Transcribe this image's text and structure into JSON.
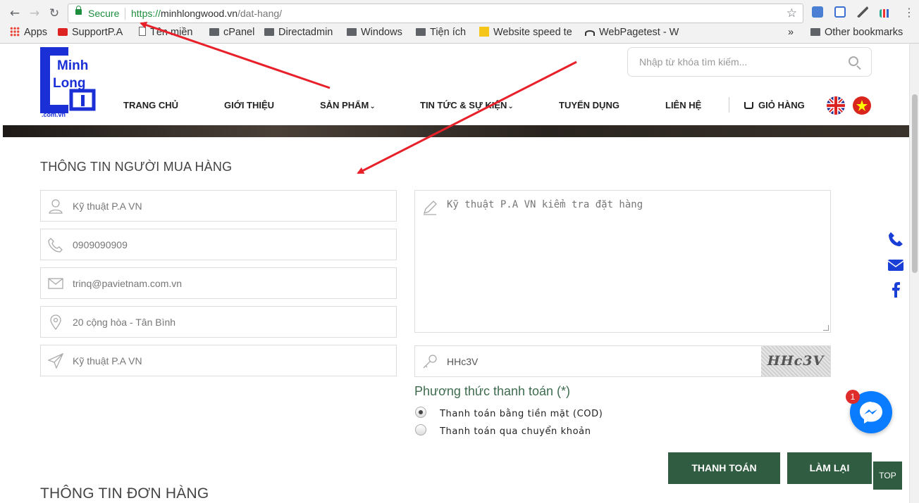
{
  "browser": {
    "secure_label": "Secure",
    "url_scheme": "https://",
    "url_host": "minhlongwood.vn",
    "url_path": "/dat-hang/",
    "more": "»"
  },
  "bookmarks": [
    {
      "label": "Apps",
      "icon": "apps-icon"
    },
    {
      "label": "SupportP.A",
      "icon": "bookmark-icon"
    },
    {
      "label": "Tên miền",
      "icon": "page-icon"
    },
    {
      "label": "cPanel",
      "icon": "folder-icon"
    },
    {
      "label": "Directadmin",
      "icon": "folder-icon"
    },
    {
      "label": "Windows",
      "icon": "folder-icon"
    },
    {
      "label": "Tiện ích",
      "icon": "folder-icon"
    },
    {
      "label": "Website speed te",
      "icon": "p-icon"
    },
    {
      "label": "WebPagetest - W",
      "icon": "gauge-icon"
    },
    {
      "label": "Other bookmarks",
      "icon": "folder-icon"
    }
  ],
  "site": {
    "logo_line1": "Minh",
    "logo_line2": "Long",
    "logo_suffix": ".com.vn",
    "search_placeholder": "Nhập từ khóa tìm kiếm..."
  },
  "menu": [
    "TRANG CHỦ",
    "GIỚI THIỆU",
    "SẢN PHẨM",
    "TIN TỨC & SỰ KIỆN",
    "TUYỂN DỤNG",
    "LIÊN HỆ",
    "GIỎ HÀNG"
  ],
  "buyer": {
    "title": "THÔNG TIN NGƯỜI MUA HÀNG",
    "name": "Kỹ thuật P.A VN",
    "phone": "0909090909",
    "email": "trinq@pavietnam.com.vn",
    "address": "20 cộng hòa - Tân Bình",
    "note_field": "Kỹ thuật P.A VN",
    "message": "Kỹ thuật P.A VN kiểm tra đặt hàng",
    "captcha_value": "HHc3V",
    "captcha_image_text": "HHc3V"
  },
  "payment": {
    "title": "Phương thức thanh toán (*)",
    "options": [
      "Thanh toán bằng tiền mặt (COD)",
      "Thanh toán qua chuyển khoản"
    ],
    "selected": 0
  },
  "actions": {
    "submit": "THANH TOÁN",
    "reset": "LÀM LẠI",
    "top": "TOP"
  },
  "order": {
    "title": "THÔNG TIN ĐƠN HÀNG"
  },
  "messenger": {
    "badge": "1"
  }
}
